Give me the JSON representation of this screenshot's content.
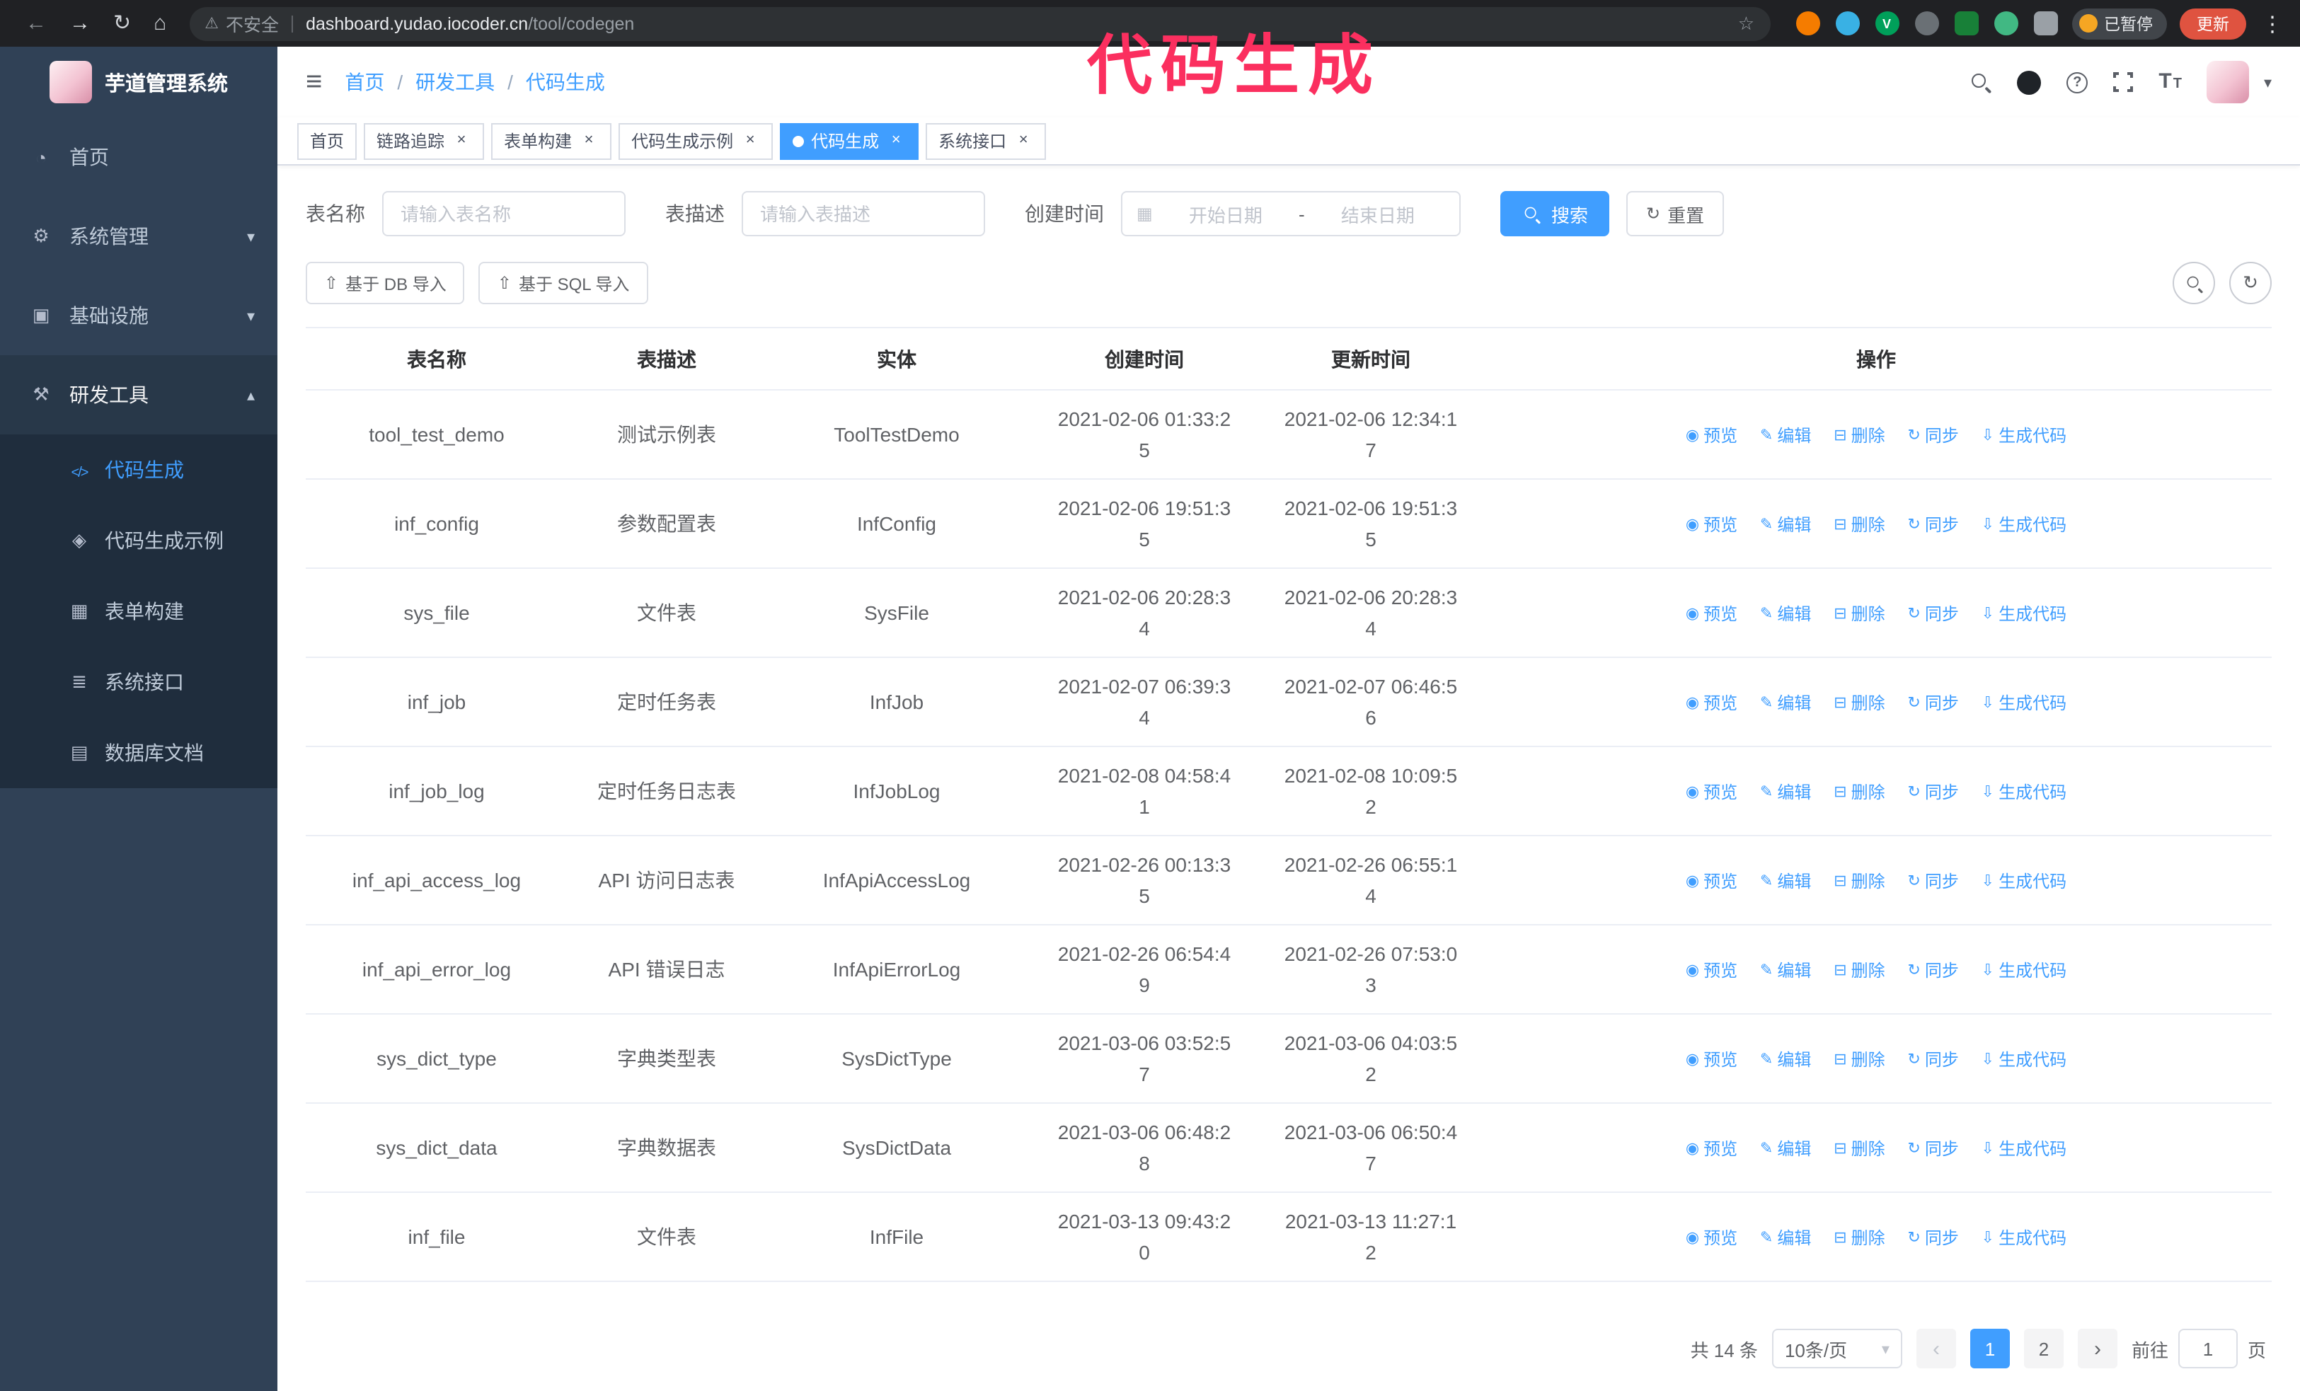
{
  "annotation": {
    "text": "代码生成",
    "color": "#fb2f5f"
  },
  "colors": {
    "accent": "#409eff",
    "sidebar_bg": "#304156",
    "submenu_bg": "#1f2d3d"
  },
  "browser": {
    "security_label": "不安全",
    "url_host": "dashboard.yudao.iocoder.cn",
    "url_path": "/tool/codegen",
    "profile_chip_label": "已暂停",
    "update_label": "更新",
    "update_color": "#df5340",
    "extensions": [
      {
        "name": "extension-orange-icon",
        "color": "#f57c00"
      },
      {
        "name": "extension-water-drop-icon",
        "color": "#39b1e4"
      },
      {
        "name": "extension-green-v-icon",
        "color": "#00a05a",
        "glyph": "V"
      },
      {
        "name": "extension-people-icon",
        "color": "#6a7075"
      },
      {
        "name": "extension-green-card-icon",
        "color": "#188038",
        "square": true
      },
      {
        "name": "extension-vue-leaf-icon",
        "color": "#41b883"
      },
      {
        "name": "extension-puzzle-icon",
        "color": "#9aa0a6",
        "square": true
      }
    ]
  },
  "sidebar": {
    "app_title": "芋道管理系统",
    "items": [
      {
        "label": "首页",
        "icon": "dashboard-icon"
      },
      {
        "label": "系统管理",
        "icon": "gear-icon",
        "chevron": "down"
      },
      {
        "label": "基础设施",
        "icon": "monitor-icon",
        "chevron": "down"
      },
      {
        "label": "研发工具",
        "icon": "tools-icon",
        "chevron": "up",
        "open": true
      }
    ],
    "submenu": [
      {
        "label": "代码生成",
        "icon": "code-icon",
        "active": true
      },
      {
        "label": "代码生成示例",
        "icon": "example-icon"
      },
      {
        "label": "表单构建",
        "icon": "form-icon"
      },
      {
        "label": "系统接口",
        "icon": "api-icon"
      },
      {
        "label": "数据库文档",
        "icon": "database-icon"
      }
    ]
  },
  "header": {
    "breadcrumb_separator": "/",
    "breadcrumb": [
      {
        "label": "首页"
      },
      {
        "label": "研发工具"
      },
      {
        "label": "代码生成",
        "last": true
      }
    ]
  },
  "tabs": [
    {
      "label": "首页",
      "pinned": true
    },
    {
      "label": "链路追踪"
    },
    {
      "label": "表单构建"
    },
    {
      "label": "代码生成示例"
    },
    {
      "label": "代码生成",
      "active": true
    },
    {
      "label": "系统接口"
    }
  ],
  "filters": {
    "table_name_label": "表名称",
    "table_name_placeholder": "请输入表名称",
    "table_desc_label": "表描述",
    "table_desc_placeholder": "请输入表描述",
    "create_time_label": "创建时间",
    "date_start_placeholder": "开始日期",
    "date_separator": "-",
    "date_end_placeholder": "结束日期",
    "search_button": "搜索",
    "reset_button": "重置"
  },
  "toolbar": {
    "import_db_label": "基于 DB 导入",
    "import_sql_label": "基于 SQL 导入"
  },
  "table": {
    "columns": [
      "表名称",
      "表描述",
      "实体",
      "创建时间",
      "更新时间",
      "操作"
    ],
    "actions": [
      {
        "label": "预览",
        "icon": "eye-icon",
        "name": "preview-link"
      },
      {
        "label": "编辑",
        "icon": "edit-icon",
        "name": "edit-link"
      },
      {
        "label": "删除",
        "icon": "delete-icon",
        "name": "delete-link"
      },
      {
        "label": "同步",
        "icon": "sync-icon",
        "name": "sync-link"
      },
      {
        "label": "生成代码",
        "icon": "download-icon",
        "name": "generate-code-link"
      }
    ],
    "rows": [
      {
        "name": "tool_test_demo",
        "desc": "测试示例表",
        "entity": "ToolTestDemo",
        "created": "2021-02-06 01:33:25",
        "updated": "2021-02-06 12:34:17"
      },
      {
        "name": "inf_config",
        "desc": "参数配置表",
        "entity": "InfConfig",
        "created": "2021-02-06 19:51:35",
        "updated": "2021-02-06 19:51:35"
      },
      {
        "name": "sys_file",
        "desc": "文件表",
        "entity": "SysFile",
        "created": "2021-02-06 20:28:34",
        "updated": "2021-02-06 20:28:34"
      },
      {
        "name": "inf_job",
        "desc": "定时任务表",
        "entity": "InfJob",
        "created": "2021-02-07 06:39:34",
        "updated": "2021-02-07 06:46:56"
      },
      {
        "name": "inf_job_log",
        "desc": "定时任务日志表",
        "entity": "InfJobLog",
        "created": "2021-02-08 04:58:41",
        "updated": "2021-02-08 10:09:52"
      },
      {
        "name": "inf_api_access_log",
        "desc": "API 访问日志表",
        "entity": "InfApiAccessLog",
        "created": "2021-02-26 00:13:35",
        "updated": "2021-02-26 06:55:14"
      },
      {
        "name": "inf_api_error_log",
        "desc": "API 错误日志",
        "entity": "InfApiErrorLog",
        "created": "2021-02-26 06:54:49",
        "updated": "2021-02-26 07:53:03"
      },
      {
        "name": "sys_dict_type",
        "desc": "字典类型表",
        "entity": "SysDictType",
        "created": "2021-03-06 03:52:57",
        "updated": "2021-03-06 04:03:52"
      },
      {
        "name": "sys_dict_data",
        "desc": "字典数据表",
        "entity": "SysDictData",
        "created": "2021-03-06 06:48:28",
        "updated": "2021-03-06 06:50:47"
      },
      {
        "name": "inf_file",
        "desc": "文件表",
        "entity": "InfFile",
        "created": "2021-03-13 09:43:20",
        "updated": "2021-03-13 11:27:12"
      }
    ]
  },
  "pagination": {
    "total": "共 14 条",
    "page_size": "10条/页",
    "pages": [
      {
        "label": "1",
        "active": true
      },
      {
        "label": "2"
      }
    ],
    "goto_label": "前往",
    "goto_value": "1",
    "goto_suffix": "页"
  }
}
